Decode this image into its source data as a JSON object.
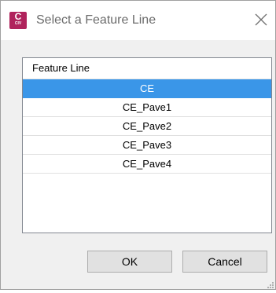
{
  "window": {
    "title": "Select a Feature Line",
    "icon": "autocad-civil3d-icon",
    "icon_letter": "C",
    "icon_sub": "CIV",
    "brand_color": "#b0235c"
  },
  "list": {
    "header": "Feature Line",
    "items": [
      "CE",
      "CE_Pave1",
      "CE_Pave2",
      "CE_Pave3",
      "CE_Pave4"
    ],
    "selected": "CE",
    "selected_color": "#3a96e8"
  },
  "buttons": {
    "ok": "OK",
    "cancel": "Cancel"
  }
}
